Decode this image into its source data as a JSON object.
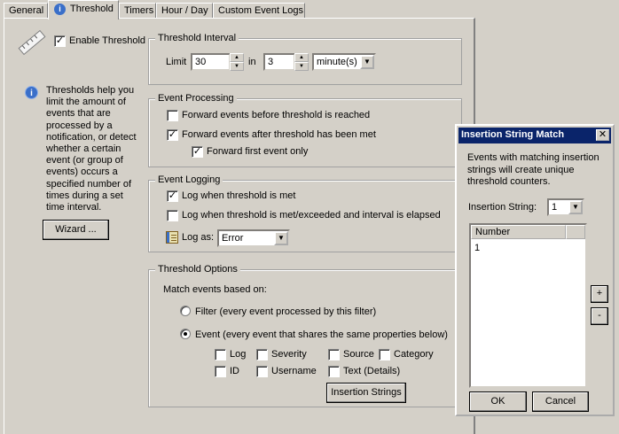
{
  "tabs": [
    "General",
    "Threshold",
    "Timers",
    "Hour / Day",
    "Custom Event Logs"
  ],
  "enable_threshold": {
    "label": "Enable Threshold",
    "checked": true
  },
  "info_text": "Thresholds help you limit the amount of events that are processed by a notification, or detect whether a certain event (or group of events) occurs a specified number of times during a set time interval.",
  "wizard_label": "Wizard ...",
  "threshold_interval": {
    "title": "Threshold Interval",
    "limit_label": "Limit",
    "limit_value": "30",
    "in_label": "in",
    "in_value": "3",
    "unit_value": "minute(s)"
  },
  "event_processing": {
    "title": "Event Processing",
    "before_label": "Forward events before threshold is reached",
    "after_label": "Forward events after threshold has been met",
    "first_label": "Forward first event only"
  },
  "event_logging": {
    "title": "Event Logging",
    "met_label": "Log when threshold is met",
    "exceeded_label": "Log when threshold is met/exceeded and interval is elapsed",
    "log_as_label": "Log as:",
    "log_as_value": "Error"
  },
  "threshold_options": {
    "title": "Threshold Options",
    "match_label": "Match events based on:",
    "filter_label": "Filter (every event processed by this filter)",
    "event_label": "Event (every event that shares the same properties below)",
    "props": {
      "log": "Log",
      "severity": "Severity",
      "source": "Source",
      "category": "Category",
      "id": "ID",
      "username": "Username",
      "text_details": "Text (Details)"
    },
    "insertion_strings_label": "Insertion Strings"
  },
  "dialog": {
    "title": "Insertion String Match",
    "description": "Events with matching insertion strings will create unique threshold counters.",
    "insertion_label": "Insertion String:",
    "insertion_value": "1",
    "list_header": "Number",
    "list_items": [
      "1"
    ],
    "plus_label": "+",
    "minus_label": "-",
    "ok_label": "OK",
    "cancel_label": "Cancel"
  }
}
